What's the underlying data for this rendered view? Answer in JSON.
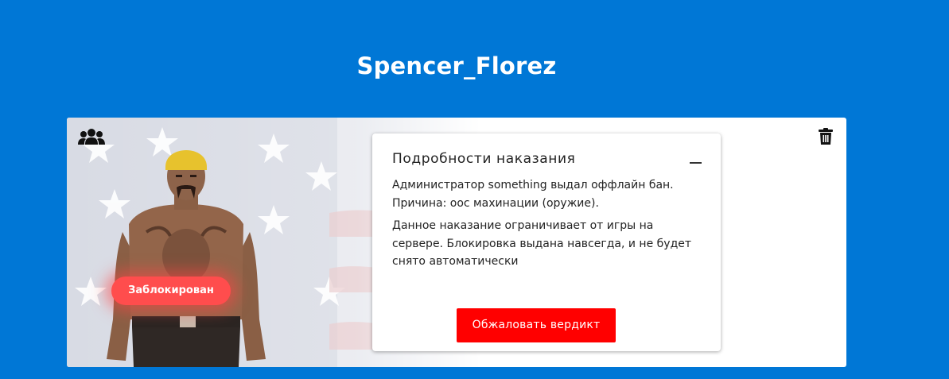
{
  "profile": {
    "username": "Spencer_Florez",
    "status_badge": "Заблокирован"
  },
  "icons": {
    "group": "users-group-icon",
    "delete": "trash-icon",
    "collapse": "minus-icon"
  },
  "details": {
    "title": "Подробности наказания",
    "line_admin": "Администратор something выдал оффлайн бан.",
    "line_reason": "Причина: оос махинации (оружие).",
    "description": "Данное наказание ограничивает от игры на сервере. Блокировка выдана навсегда, и не будет снято автоматически",
    "appeal_button": "Обжаловать вердикт"
  },
  "colors": {
    "background": "#0077d6",
    "badge": "#ff4d4d",
    "appeal_button": "#ff0000"
  }
}
